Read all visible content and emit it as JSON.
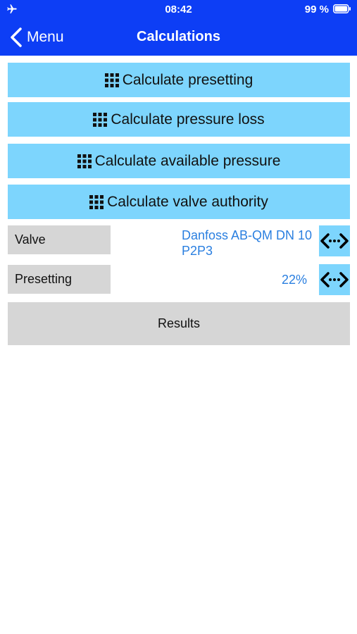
{
  "status_bar": {
    "time": "08:42",
    "battery": "99 %",
    "icons": [
      "airplane-icon",
      "battery-icon"
    ]
  },
  "nav": {
    "back_label": "Menu",
    "title": "Calculations",
    "back_icon": "chevron-left-icon"
  },
  "buttons": [
    {
      "label": "Calculate presetting",
      "icon": "grid-icon"
    },
    {
      "label": "Calculate pressure loss",
      "icon": "grid-icon"
    },
    {
      "label": "Calculate available pressure",
      "icon": "grid-icon"
    },
    {
      "label": "Calculate valve authority",
      "icon": "grid-icon"
    }
  ],
  "fields": {
    "valve": {
      "label": "Valve",
      "value_line1": "Danfoss AB-QM DN 10",
      "value_line2": "P2P3"
    },
    "presetting": {
      "label": "Presetting",
      "value": "22%"
    }
  },
  "swap_icon": "swap-arrows-icon",
  "results_label": "Results",
  "colors": {
    "header": "#0d3ef5",
    "button": "#7dd5fd",
    "label_bg": "#d6d6d6",
    "value_text": "#2a7fe0"
  }
}
